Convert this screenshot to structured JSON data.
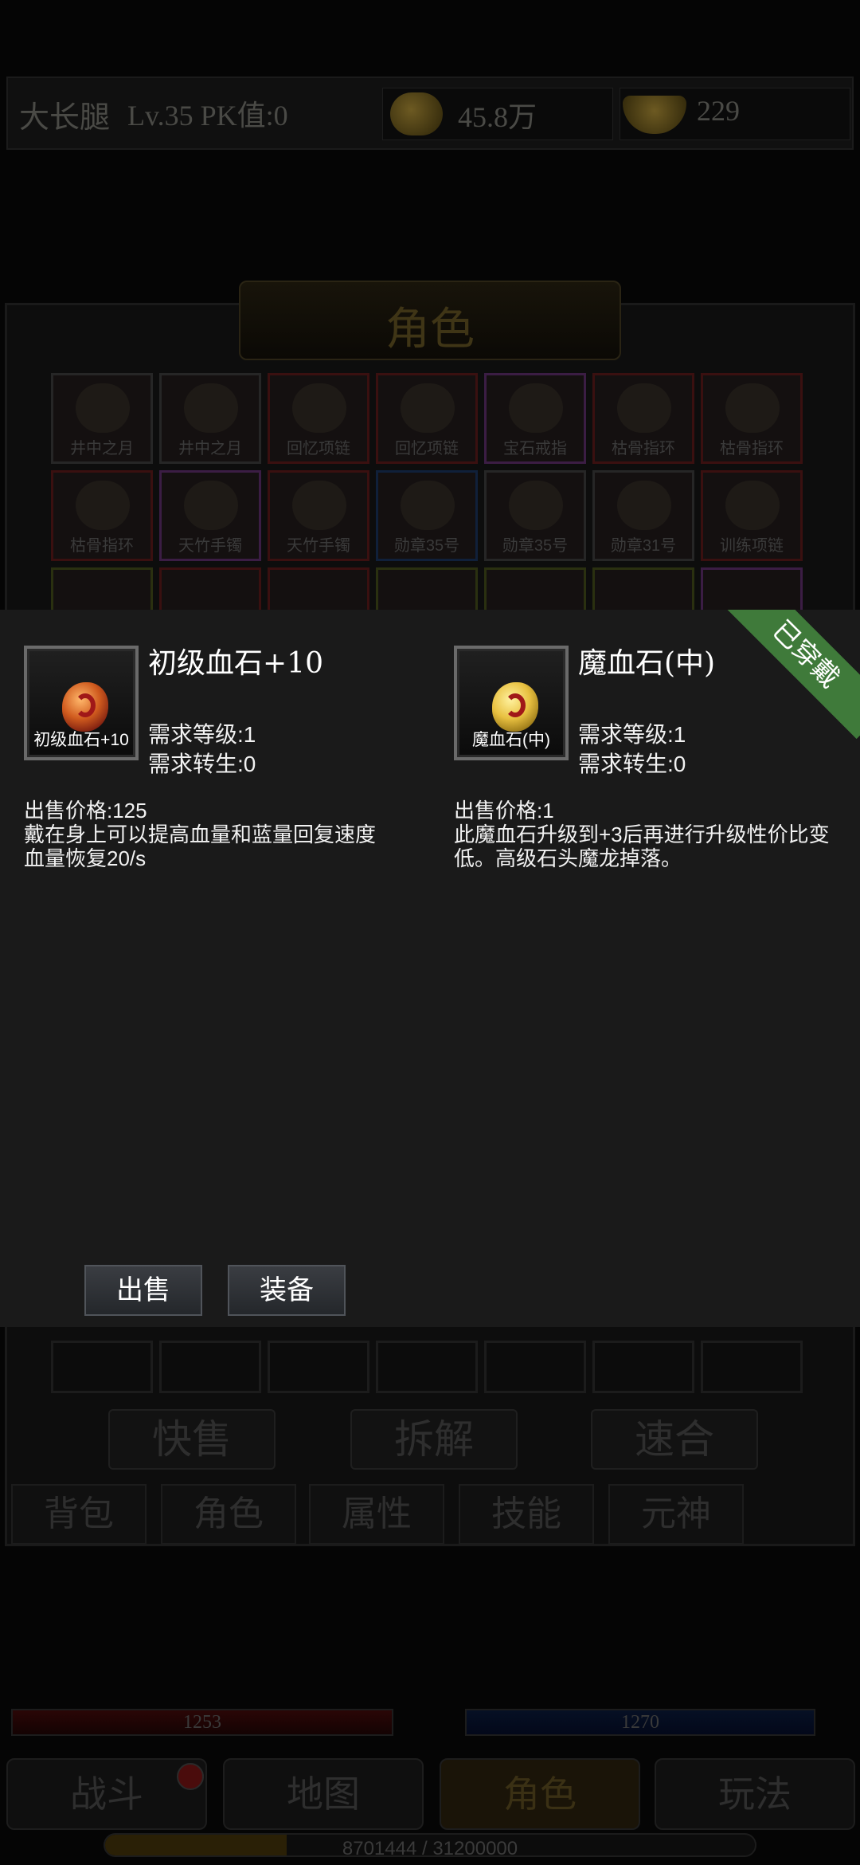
{
  "topbar": {
    "player_name": "大长腿",
    "level_pk": "Lv.35 PK值:0",
    "gold_icon": "gold-coin-icon",
    "gold_value": "45.8万",
    "ingot_icon": "gold-ingot-icon",
    "ingot_value": "229"
  },
  "character_panel": {
    "title": "角色",
    "items": [
      {
        "label": "井中之月",
        "rarity": "gray"
      },
      {
        "label": "井中之月",
        "rarity": "gray"
      },
      {
        "label": "回忆项链",
        "rarity": "red"
      },
      {
        "label": "回忆项链",
        "rarity": "red"
      },
      {
        "label": "宝石戒指",
        "rarity": "purple"
      },
      {
        "label": "枯骨指环",
        "rarity": "red"
      },
      {
        "label": "枯骨指环",
        "rarity": "red"
      },
      {
        "label": "枯骨指环",
        "rarity": "red"
      },
      {
        "label": "天竹手镯",
        "rarity": "purple"
      },
      {
        "label": "天竹手镯",
        "rarity": "red"
      },
      {
        "label": "勋章35号",
        "rarity": "blue"
      },
      {
        "label": "勋章35号",
        "rarity": "gray"
      },
      {
        "label": "勋章31号",
        "rarity": "gray"
      },
      {
        "label": "训练项链",
        "rarity": "red"
      }
    ],
    "actions": {
      "quick_sell": "快售",
      "dismantle": "拆解",
      "combine": "速合"
    },
    "tabs": {
      "bag": "背包",
      "role": "角色",
      "attributes": "属性",
      "skills": "技能",
      "spirit": "元神"
    }
  },
  "compare_modal": {
    "current_item": {
      "name": "初级血石+10",
      "icon_label": "初级血石+10",
      "icon": "red-blood-stone-icon",
      "req_level": "需求等级:1",
      "req_rebirth": "需求转生:0",
      "sell_price": "出售价格:125",
      "description_1": "戴在身上可以提高血量和蓝量回复速度",
      "description_2": "血量恢复20/s"
    },
    "equipped_item": {
      "name": "魔血石(中)",
      "icon_label": "魔血石(中)",
      "icon": "gold-blood-stone-icon",
      "req_level": "需求等级:1",
      "req_rebirth": "需求转生:0",
      "sell_price": "出售价格:1",
      "description": "此魔血石升级到+3后再进行升级性价比变低。高级石头魔龙掉落。",
      "ribbon": "已穿戴"
    },
    "buttons": {
      "sell": "出售",
      "equip": "装备"
    }
  },
  "hud": {
    "hp": "1253",
    "mp": "1270",
    "nav": {
      "battle": "战斗",
      "map": "地图",
      "role": "角色",
      "gameplay": "玩法"
    },
    "xp_text": "8701444 / 31200000",
    "xp_fraction": 0.279
  }
}
